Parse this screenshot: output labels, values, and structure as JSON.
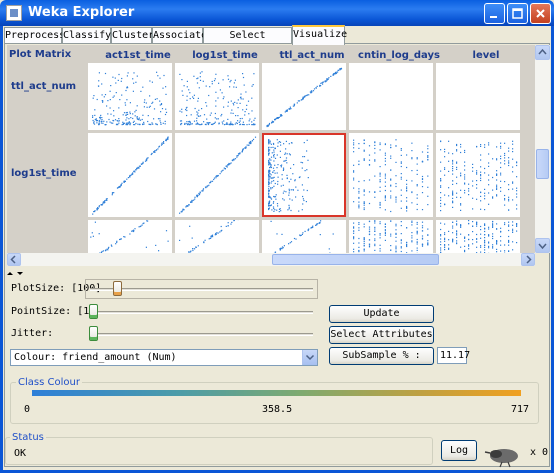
{
  "window": {
    "title": "Weka Explorer"
  },
  "tabs": [
    {
      "label": "Preprocess",
      "active": false
    },
    {
      "label": "Classify",
      "active": false
    },
    {
      "label": "Cluster",
      "active": false
    },
    {
      "label": "Associate",
      "active": false
    },
    {
      "label": "Select attributes",
      "active": false
    },
    {
      "label": "Visualize",
      "active": true
    }
  ],
  "plot_matrix": {
    "label": "Plot Matrix",
    "columns": [
      "act1st_time",
      "log1st_time",
      "ttl_act_num",
      "cntin_log_days",
      "level"
    ],
    "rows": [
      "ttl_act_num",
      "log1st_time"
    ],
    "selected_cell": {
      "row": "log1st_time",
      "column": "ttl_act_num"
    },
    "point_color": "#2e7fd8"
  },
  "controls": {
    "plot_size_label": "PlotSize: [100]",
    "point_size_label": "PointSize: [1]",
    "jitter_label": "Jitter:",
    "plot_size_value": 100,
    "point_size_value": 1,
    "jitter_value": 0,
    "update_button": "Update",
    "select_attributes_button": "Select Attributes",
    "subsample_button": "SubSample % :",
    "subsample_value": "11.17",
    "colour_select": "Colour: friend_amount  (Num)"
  },
  "class_colour": {
    "title": "Class Colour",
    "min": "0",
    "mid": "358.5",
    "max": "717",
    "colors": [
      "#2e7fd8",
      "#f0a020"
    ]
  },
  "status": {
    "title": "Status",
    "text": "OK",
    "log_button": "Log",
    "task_count": "x 0"
  }
}
